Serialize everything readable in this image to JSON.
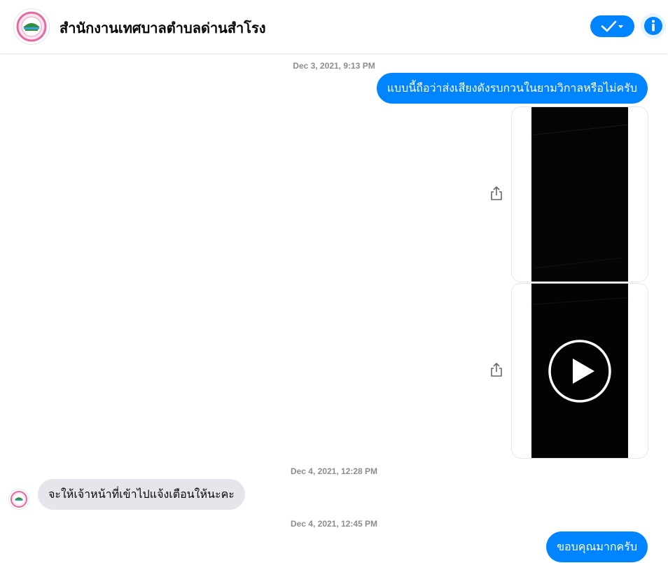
{
  "header": {
    "title": "สำนักงานเทศบาลตำบลด่านสำโรง",
    "check_icon": "check-dropdown-icon",
    "info_icon": "info-icon",
    "accent_color": "#0084ff"
  },
  "messages": [
    {
      "timestamp": "Dec 3, 2021, 9:13 PM"
    },
    {
      "direction": "outgoing",
      "text": "แบบนี้ถือว่าส่งเสียงดังรบกวนในยามวิกาลหรือไม่ครับ"
    },
    {
      "direction": "outgoing",
      "type": "media",
      "icon": "share-icon"
    },
    {
      "direction": "outgoing",
      "type": "video",
      "icon": "play-icon"
    },
    {
      "timestamp": "Dec 4, 2021, 12:28 PM"
    },
    {
      "direction": "incoming",
      "text": "จะให้เจ้าหน้าที่เข้าไปแจ้งเตือนให้นะคะ"
    },
    {
      "timestamp": "Dec 4, 2021, 12:45 PM"
    },
    {
      "direction": "outgoing",
      "text": "ขอบคุณมากครับ"
    }
  ]
}
